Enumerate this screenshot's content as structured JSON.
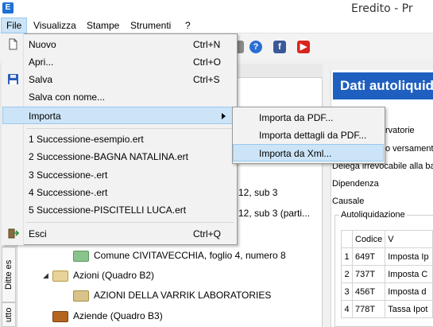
{
  "app": {
    "title": "Eredito - Pr",
    "icon_letter": "E"
  },
  "menubar": {
    "items": [
      "File",
      "Visualizza",
      "Stampe",
      "Strumenti",
      "?"
    ]
  },
  "toolbar": {
    "icons": [
      "help-icon",
      "facebook-icon",
      "youtube-icon"
    ],
    "colors": {
      "help": "#2a6ed3",
      "facebook": "#3b5998",
      "youtube": "#d8261d"
    }
  },
  "file_menu": {
    "items": [
      {
        "label": "Nuovo",
        "shortcut": "Ctrl+N",
        "icon": "new-file-icon"
      },
      {
        "label": "Apri...",
        "shortcut": "Ctrl+O",
        "icon": ""
      },
      {
        "label": "Salva",
        "shortcut": "Ctrl+S",
        "icon": "save-icon"
      },
      {
        "label": "Salva con nome...",
        "shortcut": "",
        "icon": ""
      },
      {
        "label": "Importa",
        "shortcut": "",
        "icon": "",
        "has_submenu": true
      },
      {
        "label": "1 Successione-esempio.ert",
        "shortcut": ""
      },
      {
        "label": "2 Successione-BAGNA NATALINA.ert",
        "shortcut": ""
      },
      {
        "label": "3 Successione-.ert",
        "shortcut": ""
      },
      {
        "label": "4 Successione-.ert",
        "shortcut": ""
      },
      {
        "label": "5 Successione-PISCITELLI LUCA.ert",
        "shortcut": ""
      },
      {
        "label": "Esci",
        "shortcut": "Ctrl+Q",
        "icon": "exit-icon"
      }
    ]
  },
  "import_submenu": {
    "items": [
      "Importa da PDF...",
      "Importa dettagli da PDF...",
      "Importa da Xml..."
    ]
  },
  "vertical_tabs": [
    "Ditte es",
    "utto"
  ],
  "tree": {
    "rows": [
      {
        "text": "12, sub 3"
      },
      {
        "text": "12, sub 3 (parti..."
      },
      {
        "text": "Comune CIVITAVECCHIA, foglio 4, numero 8"
      },
      {
        "text": "Azioni (Quadro B2)"
      },
      {
        "text": "AZIONI DELLA VARRIK LABORATORIES"
      },
      {
        "text": "Aziende (Quadro B3)"
      }
    ]
  },
  "right_panel": {
    "banner": "Dati autoliquid",
    "labels": [
      "rvatorie",
      "o versament",
      "Delega irrevocabile alla ba",
      "Dipendenza",
      "Causale"
    ],
    "group_title": "Autoliquidazione",
    "table": {
      "headers": [
        "",
        "Codice",
        "V"
      ],
      "rows": [
        [
          "1",
          "649T",
          "Imposta Ip"
        ],
        [
          "2",
          "737T",
          "Imposta C"
        ],
        [
          "3",
          "456T",
          "Imposta d"
        ],
        [
          "4",
          "778T",
          "Tassa Ipot"
        ]
      ]
    }
  }
}
